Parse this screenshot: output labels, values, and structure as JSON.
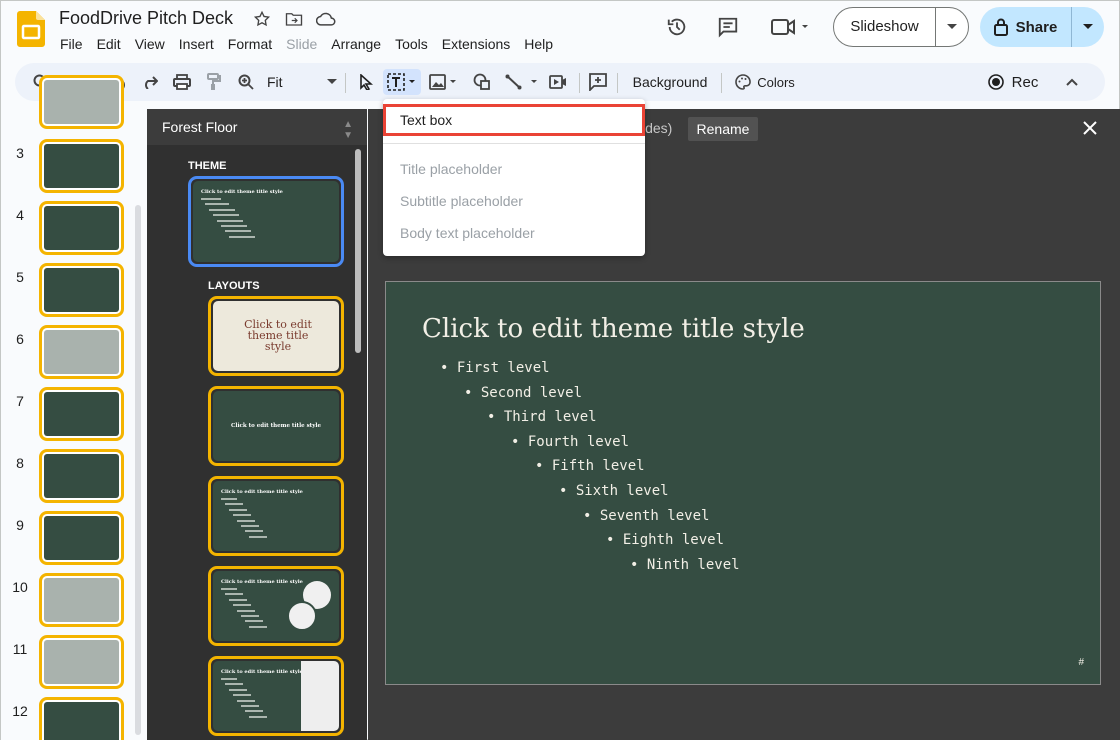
{
  "doc": {
    "title": "FoodDrive Pitch Deck"
  },
  "menu": [
    "File",
    "Edit",
    "View",
    "Insert",
    "Format",
    "Slide",
    "Arrange",
    "Tools",
    "Extensions",
    "Help"
  ],
  "menu_disabled": [
    "Slide"
  ],
  "header": {
    "slideshow_label": "Slideshow",
    "share_label": "Share"
  },
  "toolbar": {
    "zoom_label": "Fit",
    "background_label": "Background",
    "colors_label": "Colors",
    "rec_label": "Rec"
  },
  "filmstrip": {
    "slides": [
      {
        "num": "3",
        "style": "dark"
      },
      {
        "num": "4",
        "style": "dark"
      },
      {
        "num": "5",
        "style": "dark"
      },
      {
        "num": "6",
        "style": "gray"
      },
      {
        "num": "7",
        "style": "dark"
      },
      {
        "num": "8",
        "style": "dark"
      },
      {
        "num": "9",
        "style": "dark"
      },
      {
        "num": "10",
        "style": "gray"
      },
      {
        "num": "11",
        "style": "gray"
      },
      {
        "num": "12",
        "style": "dark"
      }
    ]
  },
  "theme_panel": {
    "theme_name": "Forest Floor",
    "theme_section": "THEME",
    "layouts_section": "LAYOUTS",
    "theme_thumb_title": "Click to edit theme title style",
    "layout1_title": "Click to edit theme title style",
    "layout2_title": "Click to edit theme title style",
    "layout3_title": "Click to edit theme title style",
    "layout4_title": "Click to edit theme title style",
    "layout5_title": "Click to edit theme title style"
  },
  "editor": {
    "subtitle_fragment": "ides)",
    "rename_label": "Rename",
    "slide_title": "Click to edit theme title style",
    "levels": [
      "First level",
      "Second level",
      "Third level",
      "Fourth level",
      "Fifth level",
      "Sixth level",
      "Seventh level",
      "Eighth level",
      "Ninth level"
    ],
    "slide_number": "#"
  },
  "dropdown": {
    "items": [
      {
        "label": "Text box",
        "enabled": true
      },
      {
        "label": "Title placeholder",
        "enabled": false
      },
      {
        "label": "Subtitle placeholder",
        "enabled": false
      },
      {
        "label": "Body text placeholder",
        "enabled": false
      }
    ]
  },
  "colors": {
    "slide_bg": "#354d42",
    "accent_yellow": "#f4b400",
    "highlight_red": "#ea4335",
    "selected_blue": "#4a8af4",
    "share_bg": "#c2e7ff"
  }
}
